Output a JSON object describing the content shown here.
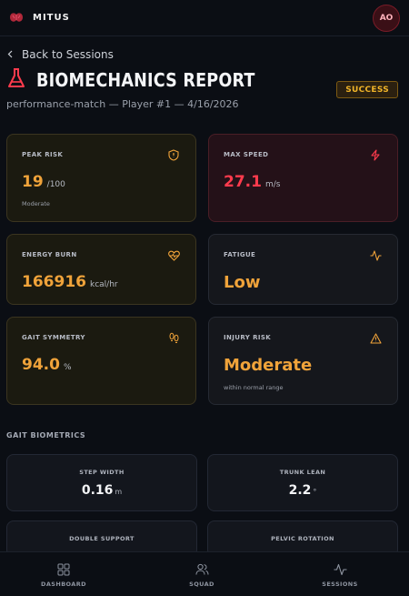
{
  "header": {
    "brand": "MITUS",
    "avatar_initials": "AO"
  },
  "back_link": "Back to Sessions",
  "title": "BIOMECHANICS REPORT",
  "subtitle": "performance-match — Player #1 — 4/16/2026",
  "status_badge": "SUCCESS",
  "cards": {
    "peak_risk": {
      "label": "PEAK RISK",
      "value": "19",
      "unit": "/100",
      "note": "Moderate",
      "icon": "shield-alert-icon"
    },
    "max_speed": {
      "label": "MAX SPEED",
      "value": "27.1",
      "unit": "m/s",
      "icon": "lightning-icon"
    },
    "energy_burn": {
      "label": "ENERGY BURN",
      "value": "166916",
      "unit": "kcal/hr",
      "icon": "heart-pulse-icon"
    },
    "fatigue": {
      "label": "FATIGUE",
      "value": "Low",
      "icon": "activity-icon"
    },
    "gait_symmetry": {
      "label": "GAIT SYMMETRY",
      "value": "94.0",
      "unit": "%",
      "icon": "footprints-icon"
    },
    "injury_risk": {
      "label": "INJURY RISK",
      "value": "Moderate",
      "note": "within normal range",
      "icon": "warning-triangle-icon"
    }
  },
  "gait_section": {
    "title": "GAIT BIOMETRICS",
    "metrics": [
      {
        "label": "STEP WIDTH",
        "value": "0.16",
        "unit": "m"
      },
      {
        "label": "TRUNK LEAN",
        "value": "2.2",
        "unit": "°"
      },
      {
        "label": "DOUBLE SUPPORT",
        "value": "",
        "unit": ""
      },
      {
        "label": "PELVIC ROTATION",
        "value": "",
        "unit": ""
      }
    ]
  },
  "bottom_nav": [
    {
      "label": "DASHBOARD",
      "icon": "dashboard-icon"
    },
    {
      "label": "SQUAD",
      "icon": "users-icon"
    },
    {
      "label": "SESSIONS",
      "icon": "activity-icon"
    }
  ],
  "colors": {
    "accent_orange": "#f0a33a",
    "accent_red": "#ff3b4d",
    "badge_gold": "#f0b429",
    "background": "#0b0e14"
  }
}
